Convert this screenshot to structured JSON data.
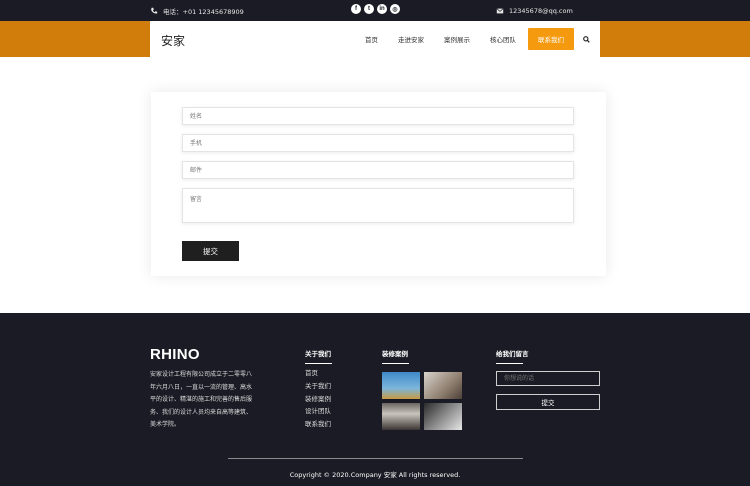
{
  "topbar": {
    "phone": "电话：+01 12345678909",
    "email": "12345678@qq.com",
    "socials": [
      {
        "icon": "facebook-icon",
        "glyph": "f"
      },
      {
        "icon": "twitter-icon",
        "glyph": "t"
      },
      {
        "icon": "linkedin-icon",
        "glyph": "in"
      },
      {
        "icon": "instagram-icon",
        "glyph": "◎"
      }
    ]
  },
  "header": {
    "brand": "安家",
    "menu": [
      "首页",
      "走进安家",
      "案例展示",
      "核心团队",
      "联系我们"
    ],
    "active_index": 4
  },
  "form": {
    "name_placeholder": "姓名",
    "phone_placeholder": "手机",
    "email_placeholder": "邮件",
    "message_placeholder": "留言",
    "submit_label": "提交"
  },
  "footer": {
    "logo": "RHINO",
    "description": "安家设计工程有限公司成立于二零零八年六月八日，一直以一流的管理、高水平的设计、精湛的施工和完善的售后服务、我们的设计人员均来自高等建筑、美术学院。",
    "about_heading": "关于我们",
    "about_links": [
      "首页",
      "关于我们",
      "装修案例",
      "设计团队",
      "联系我们"
    ],
    "cases_heading": "装修案例",
    "message_heading": "给我们留言",
    "message_placeholder": "你想说的话",
    "submit_label": "提交",
    "copyright": "Copyright © 2020.Company 安家 All rights reserved."
  }
}
